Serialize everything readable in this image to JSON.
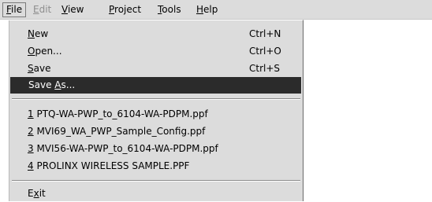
{
  "menubar": {
    "items": [
      {
        "key": "F",
        "rest": "ile",
        "disabled": false,
        "active": true
      },
      {
        "key": "E",
        "rest": "dit",
        "disabled": true,
        "active": false
      },
      {
        "key": "V",
        "rest": "iew",
        "disabled": false,
        "active": false
      },
      {
        "key": "P",
        "rest": "roject",
        "disabled": false,
        "active": false
      },
      {
        "key": "T",
        "rest": "ools",
        "disabled": false,
        "active": false
      },
      {
        "key": "H",
        "rest": "elp",
        "disabled": false,
        "active": false
      }
    ]
  },
  "file_menu": {
    "new": {
      "key": "N",
      "rest": "ew",
      "shortcut": "Ctrl+N"
    },
    "open": {
      "key": "O",
      "rest": "pen...",
      "shortcut": "Ctrl+O"
    },
    "save": {
      "key": "S",
      "rest": "ave",
      "shortcut": "Ctrl+S"
    },
    "save_as": {
      "pre": "Save ",
      "key": "A",
      "rest": "s..."
    },
    "recent": [
      {
        "key": "1",
        "rest": " PTQ-WA-PWP_to_6104-WA-PDPM.ppf"
      },
      {
        "key": "2",
        "rest": " MVI69_WA_PWP_Sample_Config.ppf"
      },
      {
        "key": "3",
        "rest": " MVI56-WA-PWP_to_6104-WA-PDPM.ppf"
      },
      {
        "key": "4",
        "rest": " PROLINX WIRELESS SAMPLE.PPF"
      }
    ],
    "exit": {
      "pre": "E",
      "key": "x",
      "rest": "it"
    }
  }
}
